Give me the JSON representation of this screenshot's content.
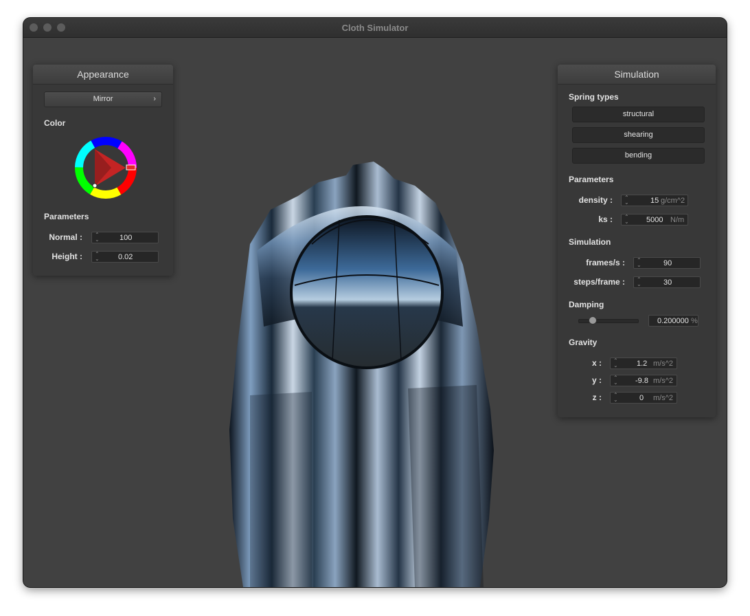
{
  "window": {
    "title": "Cloth Simulator"
  },
  "appearance": {
    "header": "Appearance",
    "shader_dropdown": "Mirror",
    "color_label": "Color",
    "params_label": "Parameters",
    "normal_label": "Normal :",
    "normal_value": "100",
    "height_label": "Height :",
    "height_value": "0.02"
  },
  "simulation": {
    "header": "Simulation",
    "spring_types_label": "Spring types",
    "spring_buttons": [
      "structural",
      "shearing",
      "bending"
    ],
    "params_label": "Parameters",
    "density_label": "density :",
    "density_value": "15",
    "density_unit": "g/cm^2",
    "ks_label": "ks :",
    "ks_value": "5000",
    "ks_unit": "N/m",
    "sim_label": "Simulation",
    "fps_label": "frames/s :",
    "fps_value": "90",
    "steps_label": "steps/frame :",
    "steps_value": "30",
    "damping_label": "Damping",
    "damping_value": "0.200000",
    "damping_unit": "%",
    "damping_level": 0.2,
    "gravity_label": "Gravity",
    "gx_label": "x :",
    "gx_value": "1.2",
    "gx_unit": "m/s^2",
    "gy_label": "y :",
    "gy_value": "-9.8",
    "gy_unit": "m/s^2",
    "gz_label": "z :",
    "gz_value": "0",
    "gz_unit": "m/s^2"
  },
  "colors": {
    "window_bg": "#414141",
    "panel_bg": "#383838",
    "selected_color": "#e52b2b"
  },
  "icons": [
    "traffic-light-close",
    "traffic-light-minimize",
    "traffic-light-zoom",
    "chevron-right-icon",
    "spinner-icon",
    "color-wheel"
  ]
}
